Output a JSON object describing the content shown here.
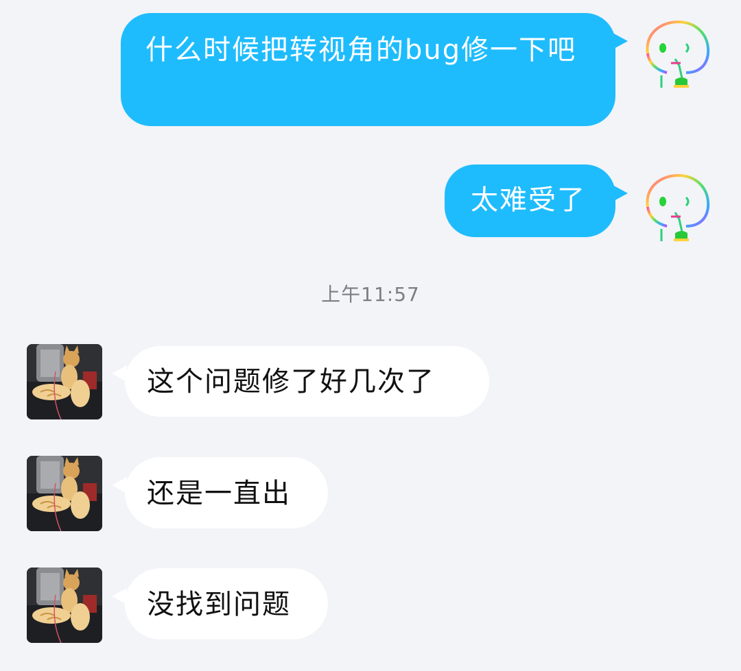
{
  "messages": [
    {
      "direction": "outgoing",
      "text": "什么时候把转视角的bug修一下吧"
    },
    {
      "direction": "outgoing",
      "text": "太难受了"
    },
    {
      "direction": "incoming",
      "text": "这个问题修了好几次了"
    },
    {
      "direction": "incoming",
      "text": "还是一直出"
    },
    {
      "direction": "incoming",
      "text": "没找到问题"
    }
  ],
  "timestamp": "上午11:57",
  "colors": {
    "background": "#f2f4f8",
    "outgoing_bubble": "#1fbcfd",
    "incoming_bubble": "#ffffff"
  },
  "icons": {
    "self_avatar": "rainbow-doodle-face-avatar",
    "contact_avatar": "cat-photo-avatar"
  }
}
